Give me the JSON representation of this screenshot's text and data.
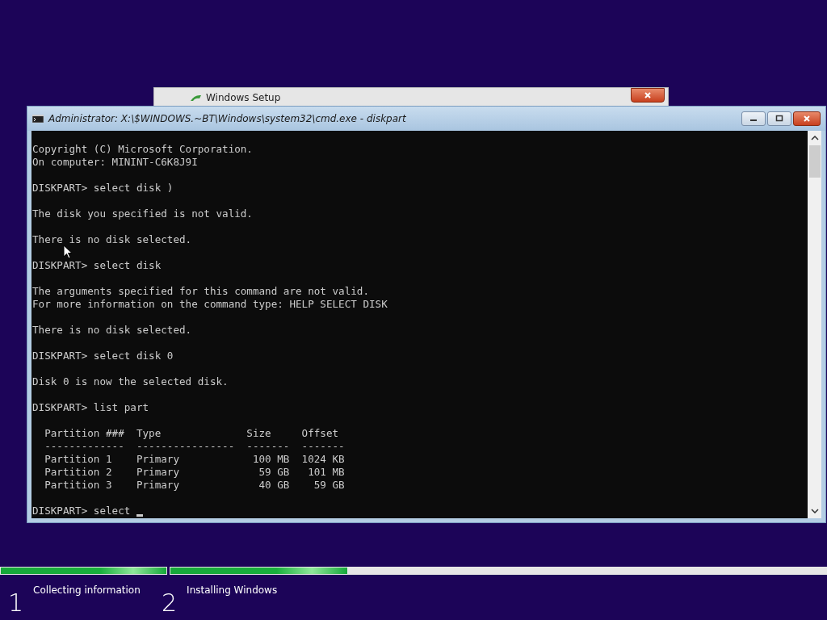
{
  "background_window": {
    "title": "Windows Setup"
  },
  "console_window": {
    "title": "Administrator: X:\\$WINDOWS.~BT\\Windows\\system32\\cmd.exe - diskpart",
    "paragraphs": [
      [
        "Copyright (C) Microsoft Corporation.",
        "On computer: MININT-C6K8J9I"
      ],
      [
        "DISKPART> select disk )"
      ],
      [
        "The disk you specified is not valid."
      ],
      [
        "There is no disk selected."
      ],
      [
        "DISKPART> select disk"
      ],
      [
        "The arguments specified for this command are not valid.",
        "For more information on the command type: HELP SELECT DISK"
      ],
      [
        "There is no disk selected."
      ],
      [
        "DISKPART> select disk 0"
      ],
      [
        "Disk 0 is now the selected disk."
      ],
      [
        "DISKPART> list part"
      ],
      [
        "  Partition ###  Type              Size     Offset",
        "  -------------  ----------------  -------  -------",
        "  Partition 1    Primary            100 MB  1024 KB",
        "  Partition 2    Primary             59 GB   101 MB",
        "  Partition 3    Primary             40 GB    59 GB"
      ],
      [
        "DISKPART> select "
      ]
    ]
  },
  "progress": [
    {
      "level": 1
    },
    {
      "level": 0.27
    }
  ],
  "steps": [
    {
      "number": "1",
      "label": "Collecting information"
    },
    {
      "number": "2",
      "label": "Installing Windows"
    }
  ]
}
